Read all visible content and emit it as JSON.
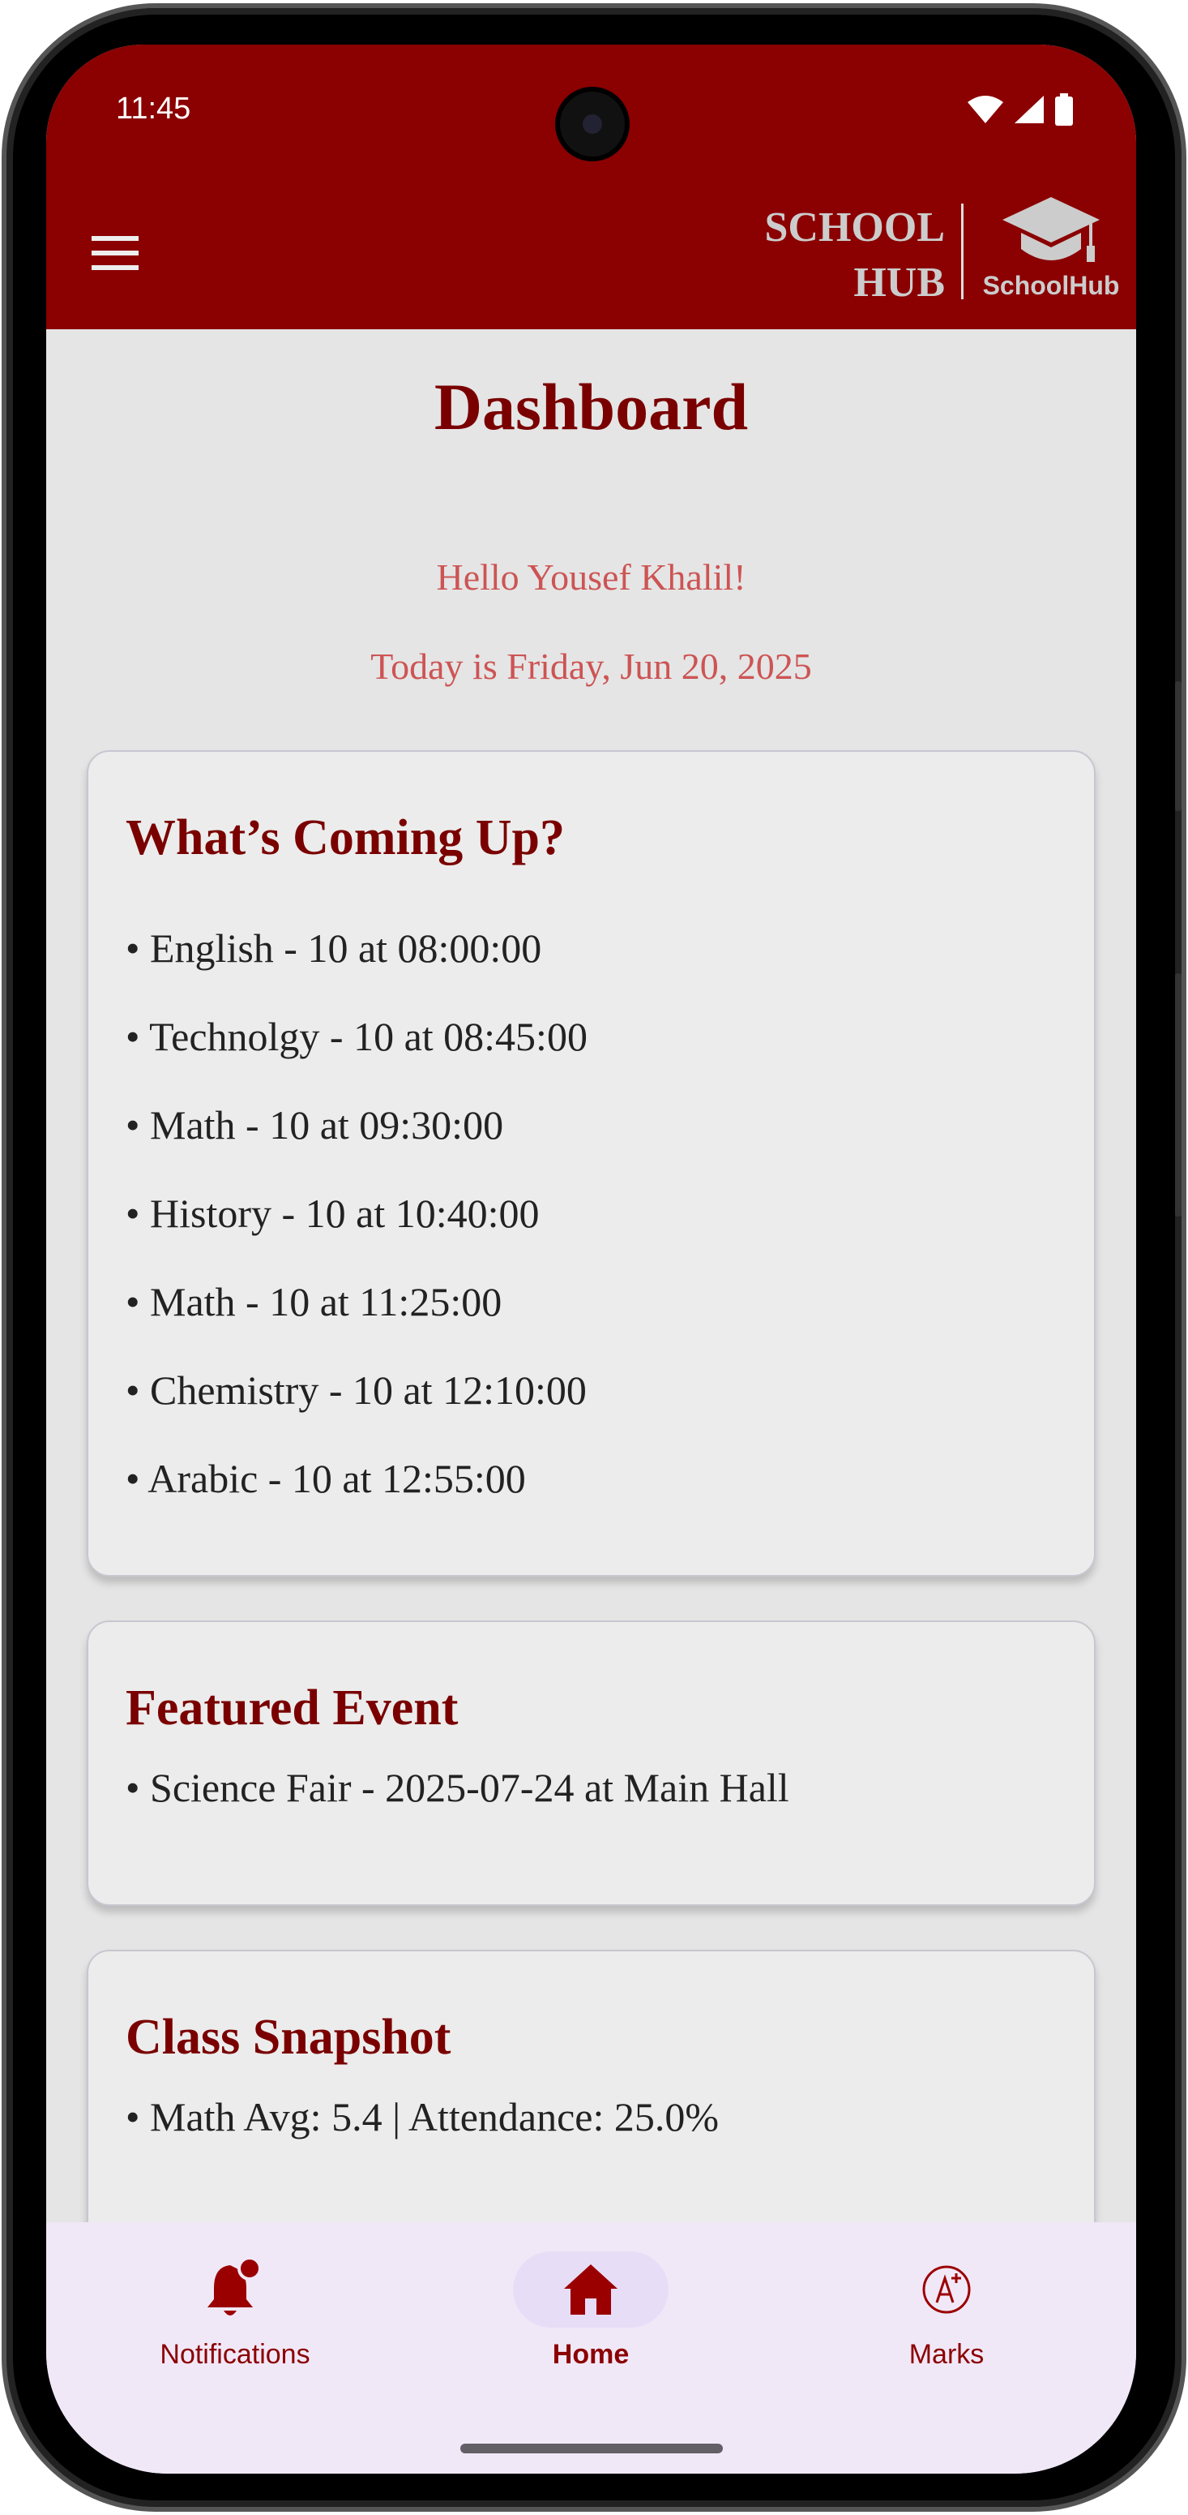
{
  "status_bar": {
    "time": "11:45",
    "icons": [
      "wifi-icon",
      "signal-icon",
      "battery-icon"
    ]
  },
  "header": {
    "menu_icon": "hamburger-menu-icon",
    "logo_line1": "SCHOOL",
    "logo_line2": "HUB",
    "logo_icon": "graduation-cap-icon",
    "logo_caption": "SchoolHub"
  },
  "page": {
    "title": "Dashboard",
    "greeting": "Hello Yousef Khalil!",
    "date_line": "Today is Friday, Jun 20, 2025"
  },
  "cards": [
    {
      "title": "What’s Coming Up?",
      "items": [
        "• English - 10 at 08:00:00",
        "• Technolgy - 10 at 08:45:00",
        "• Math - 10 at 09:30:00",
        "• History - 10 at 10:40:00",
        "• Math - 10 at 11:25:00",
        "• Chemistry - 10 at 12:10:00",
        "• Arabic - 10 at 12:55:00"
      ]
    },
    {
      "title": "Featured Event",
      "items": [
        "• Science Fair - 2025-07-24 at Main Hall"
      ]
    },
    {
      "title": "Class Snapshot",
      "items": [
        "• Math Avg: 5.4 | Attendance: 25.0%"
      ]
    }
  ],
  "bottom_nav": {
    "items": [
      {
        "label": "Notifications",
        "icon": "bell-badge-icon"
      },
      {
        "label": "Home",
        "icon": "home-icon",
        "active": true
      },
      {
        "label": "Marks",
        "icon": "grade-a-plus-icon"
      }
    ]
  },
  "colors": {
    "primary": "#8b0000",
    "title": "#7a0000",
    "greeting": "#cd5454",
    "nav_bg": "#f1e8f7",
    "active_pill": "#e8ddf7"
  }
}
